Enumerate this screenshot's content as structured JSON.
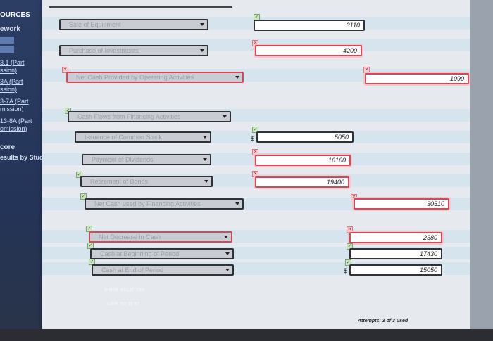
{
  "sidebar": {
    "title": "OURCES",
    "items": [
      "ework",
      "3.1 (Part",
      "ssion)",
      "3A (Part",
      "ssion)",
      "3-7A (Part",
      "mission)",
      "13-8A (Part",
      "omission)",
      "core",
      "esults by Study"
    ]
  },
  "rows": [
    {
      "key": "sale",
      "label": "Sale of Equipment",
      "value": "3110",
      "status": "ok",
      "input_value": ""
    },
    {
      "key": "purchase",
      "label": "Purchase of Investments",
      "value": "4200",
      "status": "bad"
    },
    {
      "key": "net_operating",
      "label": "Net Cash Provided by Operating Activities",
      "value": "1090",
      "status": "bad"
    },
    {
      "key": "financing_header",
      "label": "Cash Flows from Financing Activities"
    },
    {
      "key": "issuance",
      "label": "Issuance of Common Stock",
      "value": "5050",
      "status": "ok",
      "dollar": "$"
    },
    {
      "key": "dividends",
      "label": "Payment of Dividends",
      "value": "16160",
      "status": "bad"
    },
    {
      "key": "bonds",
      "label": "Retirement of Bonds",
      "value": "19400",
      "status": "bad"
    },
    {
      "key": "net_financing",
      "label": "Net Cash used by Financing Activities",
      "value": "30510",
      "status": "bad"
    },
    {
      "key": "net_decrease",
      "label": "Net Decrease in Cash",
      "value": "2380",
      "status": "bad"
    },
    {
      "key": "beginning",
      "label": "Cash at Beginning of Period",
      "value": "17430",
      "status": "ok"
    },
    {
      "key": "end",
      "label": "Cash at End of Period",
      "value": "15050",
      "status": "ok",
      "dollar": "$"
    }
  ],
  "links": {
    "show_solution": "SHOW SOLUTION",
    "link_to_text": "LINK TO TEXT"
  },
  "attempts": "Attempts: 3 of 3 used",
  "marks": {
    "ok": "✓",
    "x": "✕"
  },
  "icons": {
    "caret": "chevron-down-icon"
  }
}
